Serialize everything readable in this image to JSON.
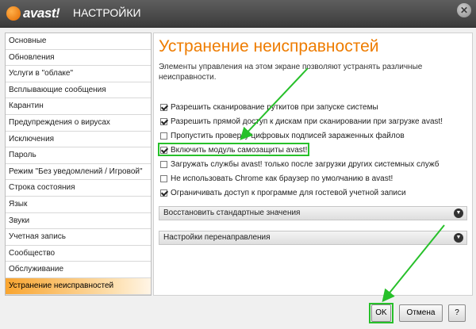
{
  "titlebar": {
    "logo_text": "avast!",
    "title": "НАСТРОЙКИ",
    "close_label": "✕"
  },
  "sidebar": {
    "items": [
      {
        "label": "Основные"
      },
      {
        "label": "Обновления"
      },
      {
        "label": "Услуги в \"облаке\""
      },
      {
        "label": "Всплывающие сообщения"
      },
      {
        "label": "Карантин"
      },
      {
        "label": "Предупреждения о вирусах"
      },
      {
        "label": "Исключения"
      },
      {
        "label": "Пароль"
      },
      {
        "label": "Режим \"Без уведомлений / Игровой\""
      },
      {
        "label": "Строка состояния"
      },
      {
        "label": "Язык"
      },
      {
        "label": "Звуки"
      },
      {
        "label": "Учетная запись"
      },
      {
        "label": "Сообщество"
      },
      {
        "label": "Обслуживание"
      },
      {
        "label": "Устранение неисправностей",
        "active": true
      }
    ]
  },
  "content": {
    "title": "Устранение неисправностей",
    "description": "Элементы управления на этом экране позволяют устранять различные неисправности.",
    "options": [
      {
        "label": "Разрешить сканирование руткитов при запуске системы",
        "checked": true
      },
      {
        "label": "Разрешить прямой доступ к дискам при сканировании при загрузке avast!",
        "checked": true
      },
      {
        "label": "Пропустить проверку цифровых подписей зараженных файлов",
        "checked": false
      },
      {
        "label": "Включить модуль самозащиты avast!",
        "checked": true
      },
      {
        "label": "Загружать службы avast! только после загрузки других системных служб",
        "checked": false
      },
      {
        "label": "Не использовать Chrome как браузер по умолчанию в avast!",
        "checked": false
      },
      {
        "label": "Ограничивать доступ к программе для гостевой учетной записи",
        "checked": true
      }
    ],
    "sections": [
      {
        "label": "Восстановить стандартные значения"
      },
      {
        "label": "Настройки перенаправления"
      }
    ]
  },
  "buttons": {
    "ok": "OK",
    "cancel": "Отмена",
    "help": "?"
  },
  "colors": {
    "accent": "#ee7c00",
    "annotation": "#27c02a"
  }
}
